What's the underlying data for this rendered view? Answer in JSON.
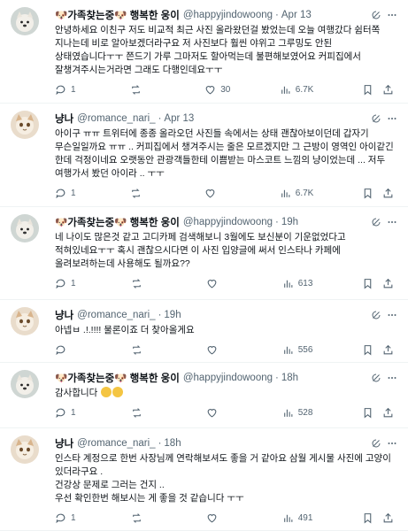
{
  "tweets": [
    {
      "name": "🐶가족찾는중🐶 행복한 웅이",
      "handle": "@happyjindowoong",
      "time": "Apr 13",
      "text": "안녕하세요 이친구 저도 비교적 최근 사진 올라왔던걸 봤었는데 오늘 여행갔다 쉼터쪽 지나는데 비로 알아보겠더라구요 저 사진보다 훨씬 야위고 그루밍도 안된 상태였습니다ㅜㅜ 쯘드기 가루 그마저도 할아먹는데 불편해보였어요 커피집에서 잘챙겨주시는거라면 그래도 다행인데요ㅜㅜ",
      "replies": "1",
      "retweets": "",
      "likes": "30",
      "views": "6.7K"
    },
    {
      "name": "냥나",
      "handle": "@romance_nari_",
      "time": "Apr 13",
      "text": "아이구 ㅠㅠ 트위터에 종종 올라오던 사진들 속에서는 상태 괜찮아보이던데 갑자기 무슨일일까요 ㅠㅠ .. 커피집에서 챙겨주시는 줄은 모르겠지만 그 근방이 영역인 아이같긴 한데 걱정이네요 오랫동안 관광객들한테 이쁨받는 마스코트 느낌의 냥이었는데 ... 저두 여행가서 봤던 아이라 .. ㅜㅜ",
      "replies": "1",
      "retweets": "",
      "likes": "",
      "views": "6.7K"
    },
    {
      "name": "🐶가족찾는중🐶 행복한 웅이",
      "handle": "@happyjindowoong",
      "time": "19h",
      "text": "네 나이도 많은것 같고 고디카페 검색해보니 3월에도 보신분이 기운없었다고 적혀있네요ㅜㅜ 혹시 괜찮으시다면 이 사진 입양글에 써서 인스타나 카페에 올려보려하는데 사용해도 될까요??",
      "replies": "1",
      "retweets": "",
      "likes": "",
      "views": "613"
    },
    {
      "name": "냥나",
      "handle": "@romance_nari_",
      "time": "19h",
      "text": "아넵ㅂ .!.!!!! 물론이죠 더 찾아올게요",
      "replies": "",
      "retweets": "",
      "likes": "",
      "views": "556"
    },
    {
      "name": "🐶가족찾는중🐶 행복한 웅이",
      "handle": "@happyjindowoong",
      "time": "18h",
      "text": "감사합니다",
      "replies": "1",
      "retweets": "",
      "likes": "",
      "views": "528"
    },
    {
      "name": "냥나",
      "handle": "@romance_nari_",
      "time": "18h",
      "text": "인스타 계정으로 한번 사장님께 연락해보셔도 좋을 거 같아요 삼월 게시물 사진에 고양이 있더라구요 .\n건강상 문제로 그러는 건지 ..\n우선 확인한번 해보시는 게 좋을 것 같습니다 ㅜㅜ",
      "replies": "1",
      "retweets": "",
      "likes": "",
      "views": "491"
    }
  ],
  "colors": {
    "text": "#0f1419",
    "muted": "#536471",
    "divider": "#eff3f4"
  },
  "icons": [
    "reply-icon",
    "retweet-icon",
    "like-icon",
    "views-icon",
    "bookmark-icon",
    "share-icon",
    "grok-icon",
    "more-icon"
  ]
}
